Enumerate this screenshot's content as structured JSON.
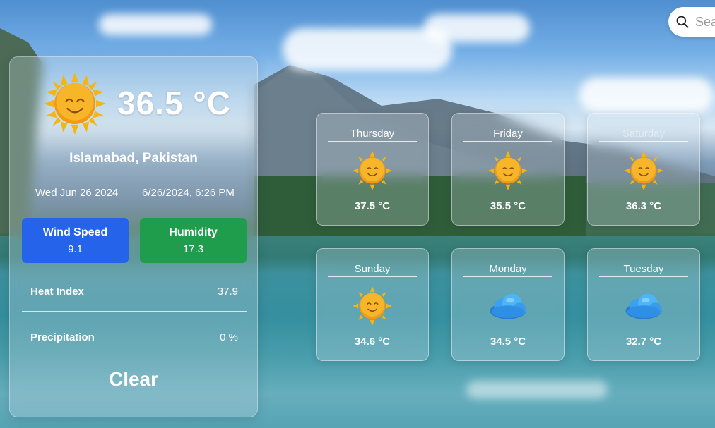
{
  "search": {
    "placeholder": "Search"
  },
  "current": {
    "temperature": "36.5 °C",
    "location": "Islamabad, Pakistan",
    "date": "Wed Jun 26 2024",
    "datetime": "6/26/2024, 6:26 PM",
    "wind_label": "Wind Speed",
    "wind_value": "9.1",
    "humidity_label": "Humidity",
    "humidity_value": "17.3",
    "heat_index_label": "Heat Index",
    "heat_index_value": "37.9",
    "precipitation_label": "Precipitation",
    "precipitation_value": "0 %",
    "condition": "Clear",
    "icon": "sun-icon"
  },
  "forecast": [
    {
      "day": "Thursday",
      "temp": "37.5 °C",
      "icon": "sun-icon"
    },
    {
      "day": "Friday",
      "temp": "35.5 °C",
      "icon": "sun-icon"
    },
    {
      "day": "Saturday",
      "temp": "36.3 °C",
      "icon": "sun-icon"
    },
    {
      "day": "Sunday",
      "temp": "34.6 °C",
      "icon": "sun-icon"
    },
    {
      "day": "Monday",
      "temp": "34.5 °C",
      "icon": "cloud-icon"
    },
    {
      "day": "Tuesday",
      "temp": "32.7 °C",
      "icon": "cloud-icon"
    }
  ],
  "colors": {
    "wind_box": "#2563eb",
    "humidity_box": "#1f9d4d"
  }
}
